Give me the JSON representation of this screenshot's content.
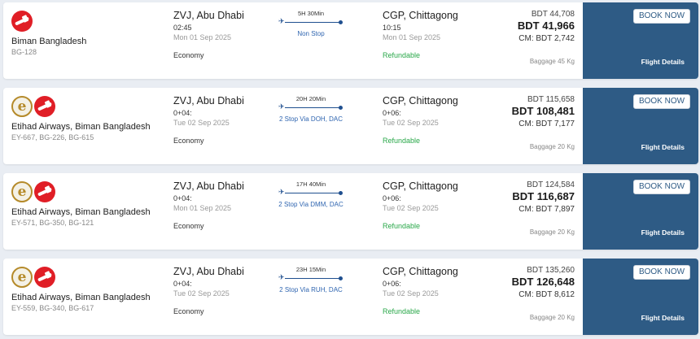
{
  "results": [
    {
      "logos": [
        "bg"
      ],
      "airline": "Biman Bangladesh",
      "flight_numbers": "BG-128",
      "departure": {
        "city": "ZVJ, Abu Dhabi",
        "time": "02:45",
        "date": "Mon 01 Sep 2025"
      },
      "arrival": {
        "city": "CGP, Chittagong",
        "time": "10:15",
        "date": "Mon 01 Sep 2025"
      },
      "duration": "5H 30Min",
      "stops": "Non Stop",
      "cabin": "Economy",
      "refundable": "Refundable",
      "gross_fare": "BDT 44,708",
      "net_fare": "BDT 41,966",
      "commission": "CM: BDT 2,742",
      "baggage": "Baggage 45 Kg",
      "book_label": "BOOK NOW",
      "details_label": "Flight Details"
    },
    {
      "logos": [
        "ey",
        "bg"
      ],
      "airline": "Etihad Airways, Biman Bangladesh",
      "flight_numbers": "EY-667, BG-226, BG-615",
      "departure": {
        "city": "ZVJ, Abu Dhabi",
        "time": "0+04:",
        "date": "Tue 02 Sep 2025"
      },
      "arrival": {
        "city": "CGP, Chittagong",
        "time": "0+06:",
        "date": "Tue 02 Sep 2025"
      },
      "duration": "20H 20Min",
      "stops": "2 Stop Via DOH, DAC",
      "cabin": "Economy",
      "refundable": "Refundable",
      "gross_fare": "BDT 115,658",
      "net_fare": "BDT 108,481",
      "commission": "CM: BDT 7,177",
      "baggage": "Baggage 20 Kg",
      "book_label": "BOOK NOW",
      "details_label": "Flight Details"
    },
    {
      "logos": [
        "ey",
        "bg"
      ],
      "airline": "Etihad Airways, Biman Bangladesh",
      "flight_numbers": "EY-571, BG-350, BG-121",
      "departure": {
        "city": "ZVJ, Abu Dhabi",
        "time": "0+04:",
        "date": "Mon 01 Sep 2025"
      },
      "arrival": {
        "city": "CGP, Chittagong",
        "time": "0+06:",
        "date": "Tue 02 Sep 2025"
      },
      "duration": "17H 40Min",
      "stops": "2 Stop Via DMM, DAC",
      "cabin": "Economy",
      "refundable": "Refundable",
      "gross_fare": "BDT 124,584",
      "net_fare": "BDT 116,687",
      "commission": "CM: BDT 7,897",
      "baggage": "Baggage 20 Kg",
      "book_label": "BOOK NOW",
      "details_label": "Flight Details"
    },
    {
      "logos": [
        "ey",
        "bg"
      ],
      "airline": "Etihad Airways, Biman Bangladesh",
      "flight_numbers": "EY-559, BG-340, BG-617",
      "departure": {
        "city": "ZVJ, Abu Dhabi",
        "time": "0+04:",
        "date": "Tue 02 Sep 2025"
      },
      "arrival": {
        "city": "CGP, Chittagong",
        "time": "0+06:",
        "date": "Tue 02 Sep 2025"
      },
      "duration": "23H 15Min",
      "stops": "2 Stop Via RUH, DAC",
      "cabin": "Economy",
      "refundable": "Refundable",
      "gross_fare": "BDT 135,260",
      "net_fare": "BDT 126,648",
      "commission": "CM: BDT 8,612",
      "baggage": "Baggage 20 Kg",
      "book_label": "BOOK NOW",
      "details_label": "Flight Details"
    }
  ],
  "icons": {
    "plane": "plane-icon",
    "route_end": "dot-icon"
  },
  "colors": {
    "sidebar": "#2e5b85",
    "refundable": "#2aa84a",
    "stops_link": "#2f65b0",
    "biman_red": "#e01e26",
    "etihad_gold": "#b58a2a"
  }
}
